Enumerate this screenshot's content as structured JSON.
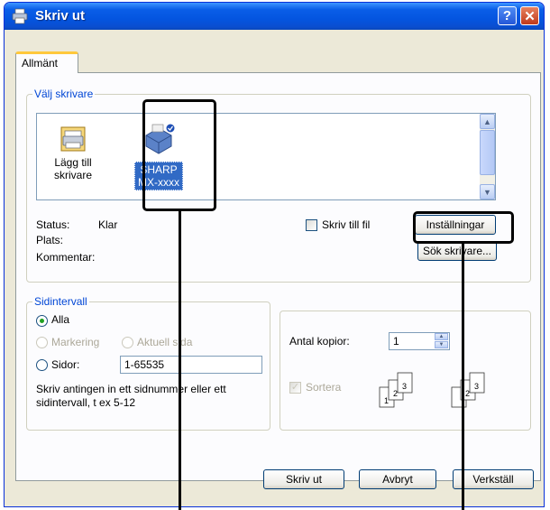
{
  "window": {
    "title": "Skriv ut",
    "help_label": "?",
    "close_label": "✕"
  },
  "tabs": [
    {
      "label": "Allmänt"
    }
  ],
  "select_printer": {
    "legend": "Välj skrivare",
    "items": [
      {
        "label_line1": "Lägg till",
        "label_line2": "skrivare",
        "icon": "add-printer-icon"
      },
      {
        "label_line1": "SHARP",
        "label_line2": "MX-xxxx",
        "icon": "printer-icon",
        "selected": true
      }
    ],
    "status_label": "Status:",
    "status_value": "Klar",
    "location_label": "Plats:",
    "comment_label": "Kommentar:",
    "print_to_file_label": "Skriv till fil",
    "preferences_button": "Inställningar",
    "find_printer_button": "Sök skrivare..."
  },
  "page_range": {
    "legend": "Sidintervall",
    "all_label": "Alla",
    "selection_label": "Markering",
    "current_page_label": "Aktuell sida",
    "pages_label": "Sidor:",
    "pages_value": "1-65535",
    "hint_line1": "Skriv antingen in ett sidnummer eller ett",
    "hint_line2": "sidintervall, t ex 5-12"
  },
  "copies": {
    "label": "Antal kopior:",
    "value": "1",
    "collate_label": "Sortera",
    "collate_pages": [
      "1",
      "2",
      "3"
    ]
  },
  "footer": {
    "print_button": "Skriv ut",
    "cancel_button": "Avbryt",
    "apply_button": "Verkställ"
  },
  "colors": {
    "titlebar": "#0a5ee8",
    "selection": "#316ac5",
    "dialog_bg": "#ece9d8",
    "highlight": "#000000"
  }
}
